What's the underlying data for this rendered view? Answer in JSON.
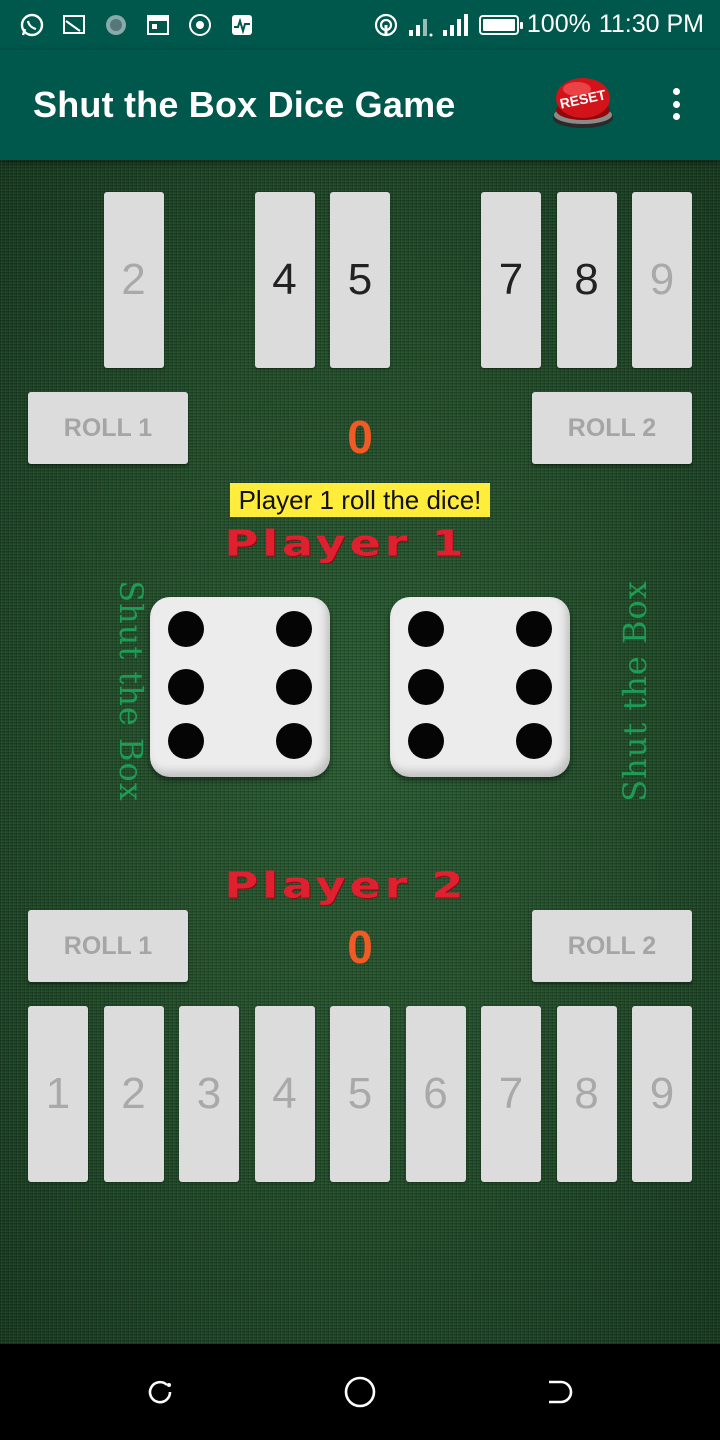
{
  "status_bar": {
    "battery": "100%",
    "time": "11:30 PM",
    "left_icons": [
      "whatsapp-icon",
      "cast-icon",
      "circle-icon",
      "calendar-icon",
      "record-icon",
      "activity-icon"
    ],
    "right_icons": [
      "hotspot-icon",
      "signal-icon",
      "signal-icon",
      "battery-icon"
    ]
  },
  "app_bar": {
    "title": "Shut the Box Dice Game",
    "reset_label": "RESET",
    "menu_icon": "more-vert-icon",
    "color": "#00574b"
  },
  "player1": {
    "label": "Player 1",
    "score": "0",
    "roll1_label": "ROLL 1",
    "roll2_label": "ROLL 2",
    "tiles": [
      {
        "label": "2",
        "slot": 2,
        "state": "shut"
      },
      {
        "label": "4",
        "slot": 4,
        "state": "open"
      },
      {
        "label": "5",
        "slot": 5,
        "state": "open"
      },
      {
        "label": "7",
        "slot": 7,
        "state": "open"
      },
      {
        "label": "8",
        "slot": 8,
        "state": "open"
      },
      {
        "label": "9",
        "slot": 9,
        "state": "shut"
      }
    ]
  },
  "player2": {
    "label": "Player 2",
    "score": "0",
    "roll1_label": "ROLL 1",
    "roll2_label": "ROLL 2",
    "tiles": [
      {
        "label": "1",
        "state": "shut"
      },
      {
        "label": "2",
        "state": "shut"
      },
      {
        "label": "3",
        "state": "shut"
      },
      {
        "label": "4",
        "state": "shut"
      },
      {
        "label": "5",
        "state": "shut"
      },
      {
        "label": "6",
        "state": "shut"
      },
      {
        "label": "7",
        "state": "shut"
      },
      {
        "label": "8",
        "state": "shut"
      },
      {
        "label": "9",
        "state": "shut"
      }
    ]
  },
  "message": "Player 1 roll the dice!",
  "side_text_left": "Shut the Box",
  "side_text_right": "Shut the Box",
  "dice": [
    {
      "value": 6
    },
    {
      "value": 6
    }
  ],
  "colors": {
    "felt": "#1f4a28",
    "score": "#f15a24",
    "player_label": "#e0202f",
    "message_bg": "#ffec3b",
    "side_text": "#1e9b55"
  },
  "nav_bar": {
    "icons": [
      "recent-apps-icon",
      "home-icon",
      "back-icon"
    ]
  }
}
